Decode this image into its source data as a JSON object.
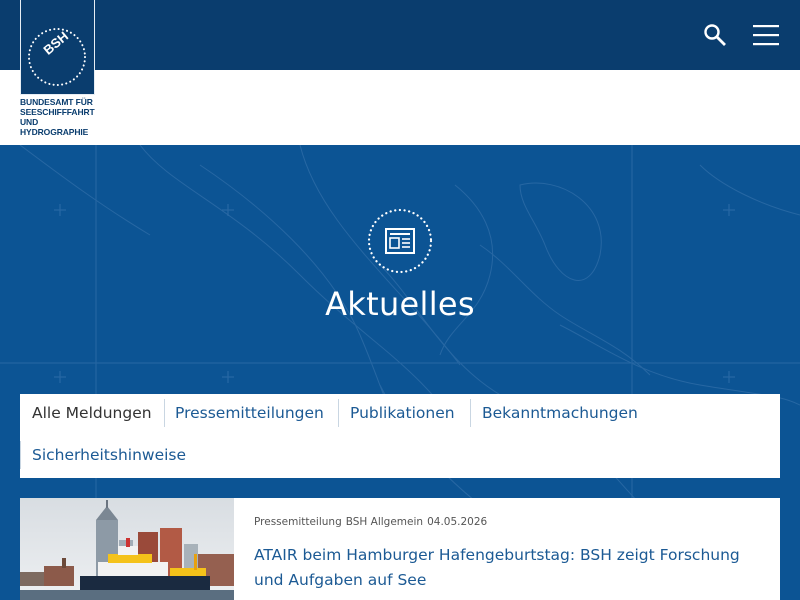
{
  "logo": {
    "emblem_text": "BSH",
    "lines": [
      "BUNDESAMT FÜR",
      "SEESCHIFFFAHRT",
      "UND",
      "HYDROGRAPHIE"
    ]
  },
  "header": {
    "search_icon": "search-icon",
    "menu_icon": "hamburger-menu-icon"
  },
  "hero": {
    "icon": "newspaper-icon",
    "title": "Aktuelles"
  },
  "filter": {
    "tabs": [
      {
        "label": "Alle Meldungen",
        "active": true
      },
      {
        "label": "Pressemitteilungen",
        "active": false
      },
      {
        "label": "Publikationen",
        "active": false
      },
      {
        "label": "Bekanntmachungen",
        "active": false
      },
      {
        "label": "Sicherheitshinweise",
        "active": false
      }
    ]
  },
  "news": [
    {
      "type": "Pressemitteilung",
      "source": "BSH Allgemein",
      "date": "04.05.2026",
      "title": "ATAIR beim Hamburger Hafengeburtstag:  BSH zeigt Forschung und Aufgaben auf See"
    }
  ],
  "colors": {
    "navy": "#0a3d6e",
    "hero_blue": "#0c5494",
    "link_blue": "#1c5a94"
  }
}
